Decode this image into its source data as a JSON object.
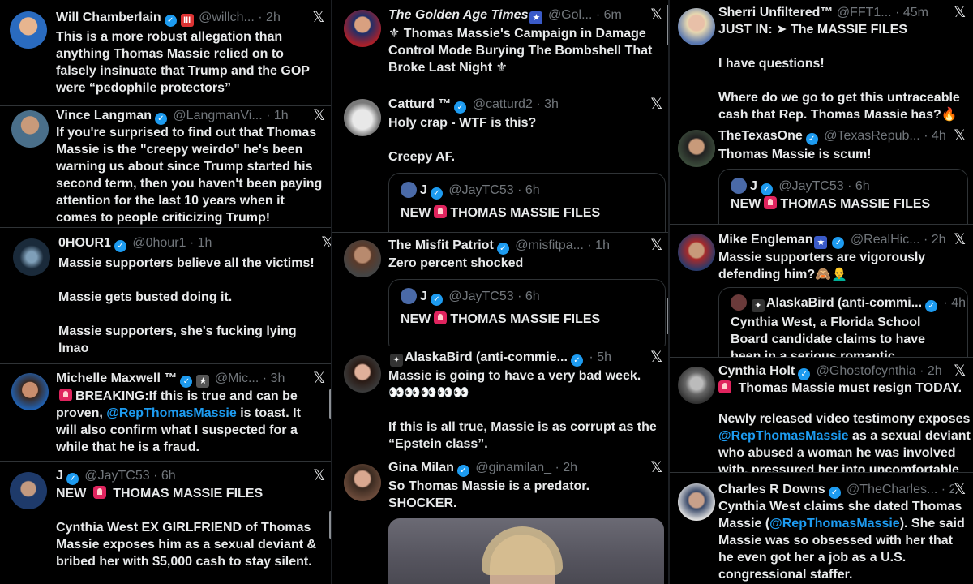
{
  "col1": [
    {
      "name": "Will Chamberlain",
      "handle": "@willch...",
      "time": "· 2h",
      "text": "This is a more robust allegation than anything Thomas Massie relied on to falsely insinuate that Trump and the GOP were “pedophile protectors”"
    },
    {
      "name": "Vince Langman",
      "handle": "@LangmanVi...",
      "time": "· 1h",
      "text": "If you're surprised to find out that Thomas Massie is the \"creepy weirdo\" he's been warning us about since Trump started his second term, then you haven't been paying attention for the last 10 years when it comes to people criticizing Trump!"
    },
    {
      "name": "0HOUR1",
      "handle": "@0hour1",
      "time": "· 1h",
      "text": "Massie supporters believe all the victims!\n\nMassie gets busted doing it.\n\nMassie supporters, she's fucking lying lmao"
    },
    {
      "name": "Michelle Maxwell ™",
      "handle": "@Mic...",
      "time": "· 3h",
      "text_a": "BREAKING:If this is true and can be proven, ",
      "mention": "@RepThomasMassie",
      "text_b": " is toast. It will also confirm what I suspected for a while that he is a fraud."
    },
    {
      "name": "J",
      "handle": "@JayTC53",
      "time": "· 6h",
      "text_a": "NEW ",
      "text_b": " THOMAS MASSIE FILES",
      "text_c": "Cynthia West EX GIRLFRIEND of Thomas Massie exposes him as a sexual deviant & bribed her with $5,000 cash to stay silent."
    }
  ],
  "col2": [
    {
      "name": "The Golden Age Times",
      "handle": "@Gol...",
      "time": "· 6m",
      "text": "⚜ Thomas Massie's Campaign in Damage Control Mode Burying The Bombshell That Broke Last Night ⚜"
    },
    {
      "name": "Catturd ™",
      "handle": "@catturd2",
      "time": "· 3h",
      "text": "Holy crap - WTF is this?\n\nCreepy AF.",
      "quote": {
        "name": "J",
        "handle": "@JayTC53",
        "time": "· 6h",
        "text_a": "NEW",
        "text_b": "THOMAS MASSIE FILES"
      }
    },
    {
      "name": "The Misfit Patriot",
      "handle": "@misfitpa...",
      "time": "· 1h",
      "text": "Zero percent shocked",
      "quote": {
        "name": "J",
        "handle": "@JayTC53",
        "time": "· 6h",
        "text_a": "NEW",
        "text_b": "THOMAS MASSIE FILES"
      }
    },
    {
      "name": "AlaskaBird (anti-commie...",
      "handle": "",
      "time": "· 5h",
      "text": "Massie is going to have a very bad week.\n👀👀👀👀👀\n\nIf this is all true, Massie is as corrupt as the “Epstein class”."
    },
    {
      "name": "Gina Milan",
      "handle": "@ginamilan_",
      "time": "· 2h",
      "text": "So Thomas Massie is a predator.\nSHOCKER."
    }
  ],
  "col3": [
    {
      "name": "Sherri Unfiltered™",
      "handle": "@FFT1...",
      "time": "· 45m",
      "text": "JUST IN: ➤ The MASSIE FILES\n\nI have questions!\n\nWhere do we go to get this untraceable cash that Rep. Thomas Massie has?🔥"
    },
    {
      "name": "TheTexasOne",
      "handle": "@TexasRepub...",
      "time": "· 4h",
      "text": "Thomas Massie is scum!",
      "quote": {
        "name": "J",
        "handle": "@JayTC53",
        "time": "· 6h",
        "text_a": "NEW",
        "text_b": "THOMAS MASSIE FILES"
      }
    },
    {
      "name": "Mike Engleman",
      "handle": "@RealHic...",
      "time": "· 2h",
      "text": "Massie supporters are vigorously defending him?🙈👨‍🦲",
      "quote": {
        "name": "AlaskaBird (anti-commi...",
        "time": "· 4h",
        "text": "Cynthia West, a Florida School Board candidate claims to have been in a serious romantic relationship with"
      }
    },
    {
      "name": "Cynthia Holt",
      "handle": "@Ghostofcynthia",
      "time": "· 2h",
      "text_a": " Thomas Massie must resign TODAY.",
      "text_b": "Newly released video testimony exposes ",
      "mention": "@RepThomasMassie",
      "text_c": " as a sexual deviant who abused a woman he was involved with, pressured her into uncomfortable acts,"
    },
    {
      "name": "Charles R Downs",
      "handle": "@TheCharles...",
      "time": "· 2h",
      "text_a": "Cynthia West claims she dated Thomas Massie (",
      "mention": "@RepThomasMassie",
      "text_b": "). She said Massie was so obsessed with her that he even got her a job as a U.S. congressional staffer."
    }
  ],
  "x_label": "𝕏"
}
